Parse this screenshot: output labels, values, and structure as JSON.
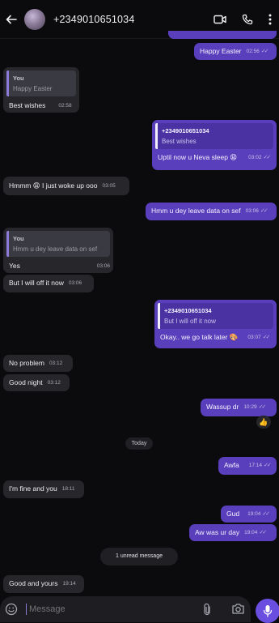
{
  "header": {
    "title": "+2349010651034",
    "back_icon": "back-arrow-icon",
    "actions": [
      "video-call-icon",
      "phone-call-icon",
      "more-vertical-icon"
    ]
  },
  "messages": [
    {
      "text": "Happy Easter",
      "time": "02:56",
      "dir": "out"
    },
    {
      "quote_author": "You",
      "quote_text": "Happy Easter",
      "text": "Best wishes",
      "time": "02:58",
      "dir": "in"
    },
    {
      "quote_author": "+2349010651034",
      "quote_text": "Best wishes",
      "text": "Uptil now u Neva sleep 😩",
      "time": "03:02",
      "dir": "out"
    },
    {
      "text": "Hmmm 😩 I just woke up ooo",
      "time": "03:05",
      "dir": "in"
    },
    {
      "text": "Hmm u dey leave data on sef",
      "time": "03:06",
      "dir": "out"
    },
    {
      "quote_author": "You",
      "quote_text": "Hmm u dey leave data on sef",
      "text": "Yes",
      "time": "03:06",
      "dir": "in"
    },
    {
      "text": "But I will off it now",
      "time": "03:06",
      "dir": "in"
    },
    {
      "quote_author": "+2349010651034",
      "quote_text": "But I will off it now",
      "text": "Okay.. we go talk later 🎨",
      "time": "03:07",
      "dir": "out"
    },
    {
      "text": "No problem",
      "time": "03:12",
      "dir": "in"
    },
    {
      "text": "Good night",
      "time": "03:12",
      "dir": "in"
    },
    {
      "text": "Wassup dr",
      "time": "10:29",
      "dir": "out"
    },
    {
      "text": "Awfa",
      "time": "17:14",
      "dir": "out"
    },
    {
      "text": "I'm fine and you",
      "time": "18:11",
      "dir": "in"
    },
    {
      "text": "Gud",
      "time": "19:04",
      "dir": "out"
    },
    {
      "text": "Aw was ur day",
      "time": "19:04",
      "dir": "out"
    },
    {
      "text": "Good and yours",
      "time": "19:14",
      "dir": "in"
    }
  ],
  "reaction": "👍",
  "date_separator": "Today",
  "unread_banner": "1 unread message",
  "composer": {
    "placeholder": "Message",
    "icons": [
      "emoji-icon",
      "attach-icon",
      "camera-icon",
      "mic-icon"
    ]
  },
  "colors": {
    "background": "#0b0b0e",
    "outgoing_bubble": "#5a3fbc",
    "incoming_bubble": "#26262b",
    "mic_button": "#6a4ee0"
  }
}
